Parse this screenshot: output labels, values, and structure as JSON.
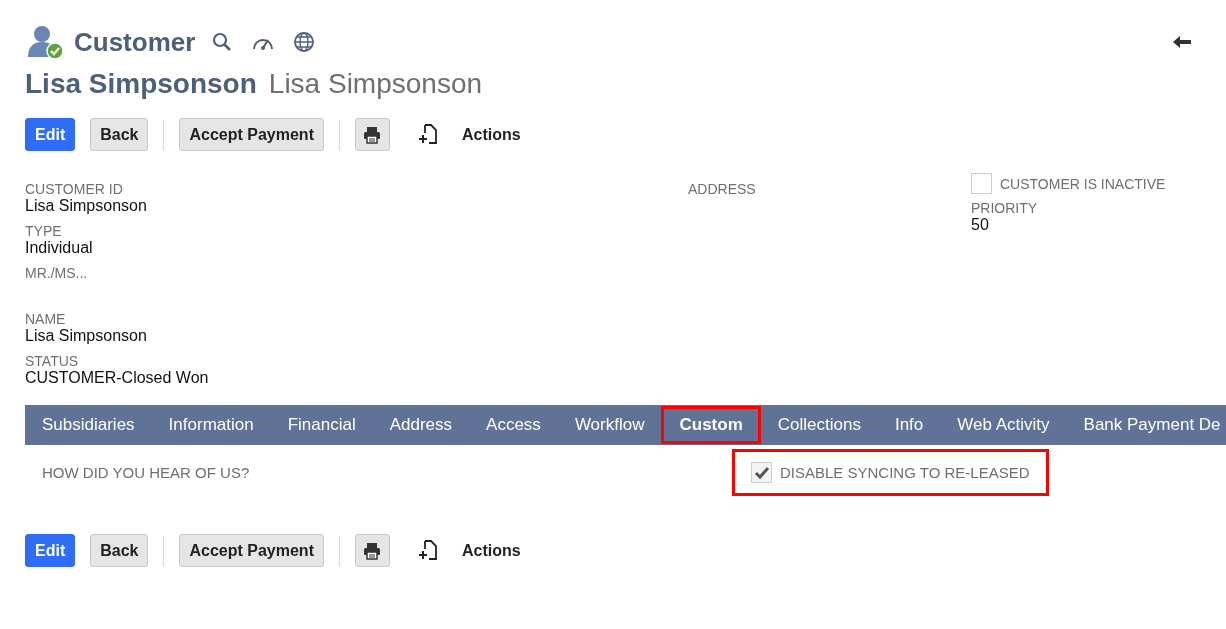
{
  "record_type": "Customer",
  "title": {
    "name": "Lisa Simpsonson",
    "subtitle": "Lisa Simpsonson"
  },
  "toolbar_top": {
    "edit": "Edit",
    "back": "Back",
    "accept_payment": "Accept Payment",
    "actions": "Actions"
  },
  "fields_left": [
    {
      "label": "CUSTOMER ID",
      "value": "Lisa Simpsonson"
    },
    {
      "label": "TYPE",
      "value": "Individual"
    },
    {
      "label": "MR./MS..."
    },
    {
      "label": "NAME",
      "value": "Lisa Simpsonson"
    },
    {
      "label": "STATUS",
      "value": "CUSTOMER-Closed Won"
    }
  ],
  "fields_middle": [
    {
      "label": "ADDRESS"
    }
  ],
  "inactive_checkbox": {
    "label": "CUSTOMER IS INACTIVE",
    "checked": false
  },
  "fields_right": [
    {
      "label": "PRIORITY",
      "value": "50"
    }
  ],
  "tabs": [
    {
      "label": "Subsidiaries",
      "selected": false,
      "highlighted": false
    },
    {
      "label": "Information",
      "selected": false,
      "highlighted": false
    },
    {
      "label": "Financial",
      "selected": false,
      "highlighted": false
    },
    {
      "label": "Address",
      "selected": false,
      "highlighted": false
    },
    {
      "label": "Access",
      "selected": false,
      "highlighted": false
    },
    {
      "label": "Workflow",
      "selected": false,
      "highlighted": false
    },
    {
      "label": "Custom",
      "selected": true,
      "highlighted": true
    },
    {
      "label": "Collections",
      "selected": false,
      "highlighted": false
    },
    {
      "label": "Info",
      "selected": false,
      "highlighted": false
    },
    {
      "label": "Web Activity",
      "selected": false,
      "highlighted": false
    },
    {
      "label": "Bank Payment De",
      "selected": false,
      "highlighted": false
    }
  ],
  "custom_tab": {
    "question_label": "HOW DID YOU HEAR OF US?",
    "sync_checkbox": {
      "label": "DISABLE SYNCING TO RE-LEASED",
      "checked": true,
      "highlighted": true
    }
  },
  "toolbar_bottom": {
    "edit": "Edit",
    "back": "Back",
    "accept_payment": "Accept Payment",
    "actions": "Actions"
  }
}
